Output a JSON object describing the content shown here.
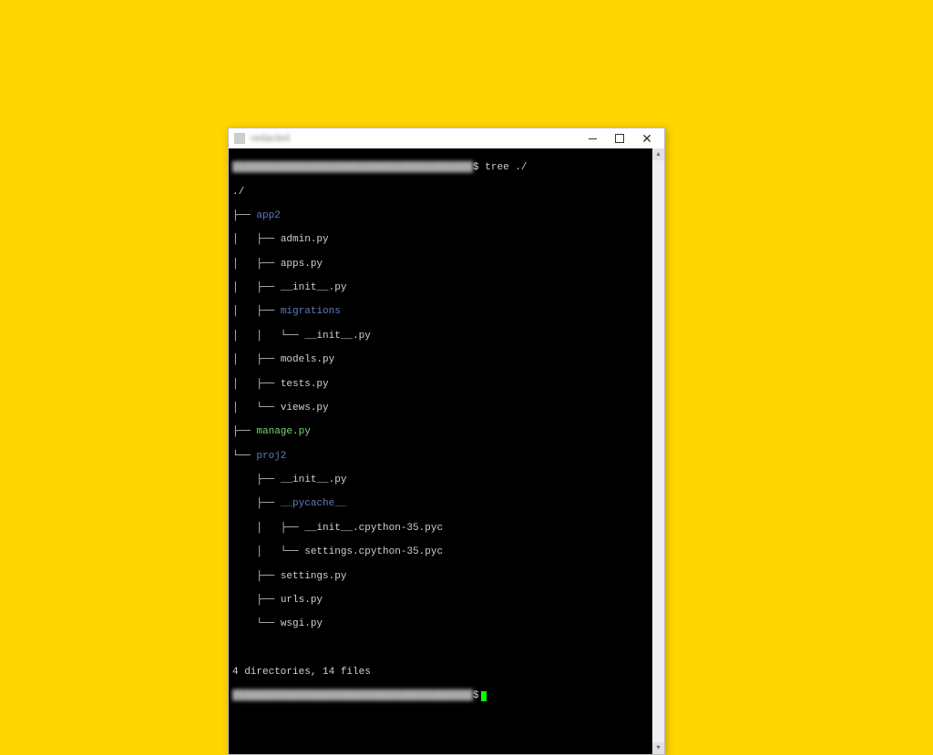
{
  "window": {
    "title": "redacted",
    "controls": {
      "min": "—",
      "max": "□",
      "close": "✕"
    }
  },
  "prompt1": {
    "user_host": "████████████████████████████████████████",
    "sep": "$",
    "cmd": "tree ./"
  },
  "tree": {
    "root": "./",
    "l1": "├── ",
    "l2": "│   ├── ",
    "l2l": "│   └── ",
    "l3": "│   │   └── ",
    "l1l": "└── ",
    "l2b": "    ├── ",
    "l2bl": "    └── ",
    "l3b": "    │   ├── ",
    "l3bl": "    │   └── ",
    "d_app2": "app2",
    "f_admin": "admin.py",
    "f_apps": "apps.py",
    "f_init1": "__init__.py",
    "d_mig": "migrations",
    "f_miginit": "__init__.py",
    "f_models": "models.py",
    "f_tests": "tests.py",
    "f_views": "views.py",
    "f_manage": "manage.py",
    "d_proj": "proj2",
    "f_pinit": "__init__.py",
    "d_pycache": "__pycache__",
    "f_pyc1": "__init__.cpython-35.pyc",
    "f_pyc2": "settings.cpython-35.pyc",
    "f_settings": "settings.py",
    "f_urls": "urls.py",
    "f_wsgi": "wsgi.py"
  },
  "summary": "4 directories, 14 files",
  "prompt2": {
    "user_host": "████████████████████████████████████████",
    "sep": "$"
  }
}
